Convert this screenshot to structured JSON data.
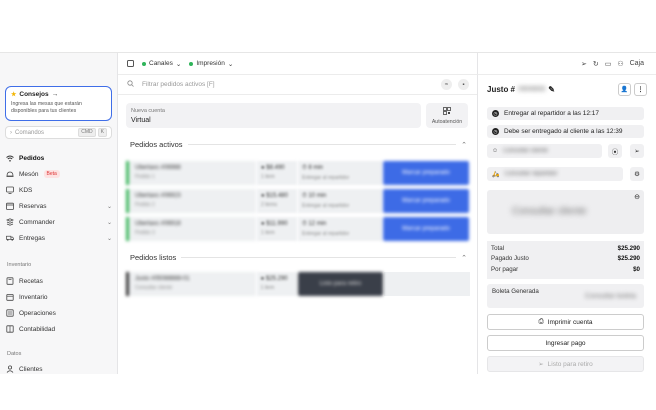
{
  "sidebar": {
    "tips_title": "Consejos",
    "tips_text": "Ingresa las mesas que estarán disponibles para tus clientes",
    "commands_placeholder": "Comandos",
    "commands_kbd": [
      "CMD",
      "K"
    ],
    "nav": [
      {
        "label": "Pedidos"
      },
      {
        "label": "Mesón",
        "badge": "Beta"
      },
      {
        "label": "KDS"
      },
      {
        "label": "Reservas"
      },
      {
        "label": "Commander"
      },
      {
        "label": "Entregas"
      }
    ],
    "inventory_label": "Inventario",
    "inventory": [
      {
        "label": "Recetas"
      },
      {
        "label": "Inventario"
      },
      {
        "label": "Operaciones"
      },
      {
        "label": "Contabilidad"
      }
    ],
    "data_label": "Datos",
    "data": [
      {
        "label": "Clientes"
      }
    ]
  },
  "topbar": {
    "channels": "Canales",
    "print": "Impresión",
    "cash": "Caja"
  },
  "search": {
    "placeholder": "Filtrar pedidos activos [F]"
  },
  "table": {
    "label": "Nueva cuenta",
    "value": "Virtual",
    "auto_label": "Autoatención"
  },
  "active_orders": {
    "title": "Pedidos activos"
  },
  "ready_orders": {
    "title": "Pedidos listos"
  },
  "panel": {
    "title": "Justo #",
    "deliver_rider": "Entregar al repartidor a las 12:17",
    "deliver_client": "Debe ser entregado al cliente a las 12:39",
    "total_label": "Total",
    "total_value": "$25.290",
    "paid_label": "Pagado Justo",
    "paid_value": "$25.290",
    "due_label": "Por pagar",
    "due_value": "$0",
    "boleta_label": "Boleta Generada",
    "print_button": "Imprimir cuenta",
    "pay_button": "Ingresar pago",
    "ready_button": "Listo para retiro"
  },
  "colors": {
    "accent": "#3d6be6",
    "status_green": "#39b55a",
    "beta_red": "#d33333"
  }
}
